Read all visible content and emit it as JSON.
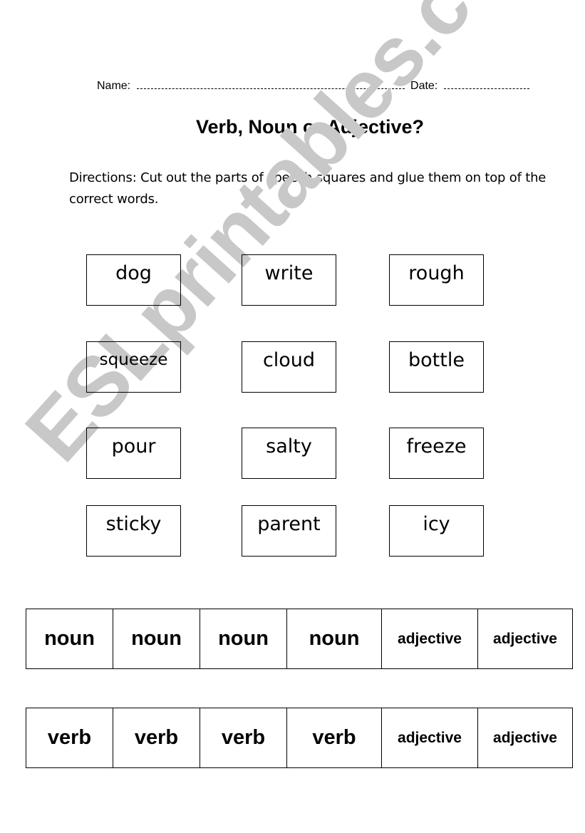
{
  "header": {
    "name_label": "Name:",
    "date_label": "Date:"
  },
  "title": "Verb, Noun or Adjective?",
  "directions": "Directions: Cut out the parts of speech squares and glue them on top of the correct words.",
  "word_boxes": [
    [
      "dog",
      "write",
      "rough"
    ],
    [
      "squeeze",
      "cloud",
      "bottle"
    ],
    [
      "pour",
      "salty",
      "freeze"
    ],
    [
      "sticky",
      "parent",
      "icy"
    ]
  ],
  "cutout_rows": [
    [
      "noun",
      "noun",
      "noun",
      "noun",
      "adjective",
      "adjective"
    ],
    [
      "verb",
      "verb",
      "verb",
      "verb",
      "adjective",
      "adjective"
    ]
  ],
  "watermark": "ESLprintables.com"
}
